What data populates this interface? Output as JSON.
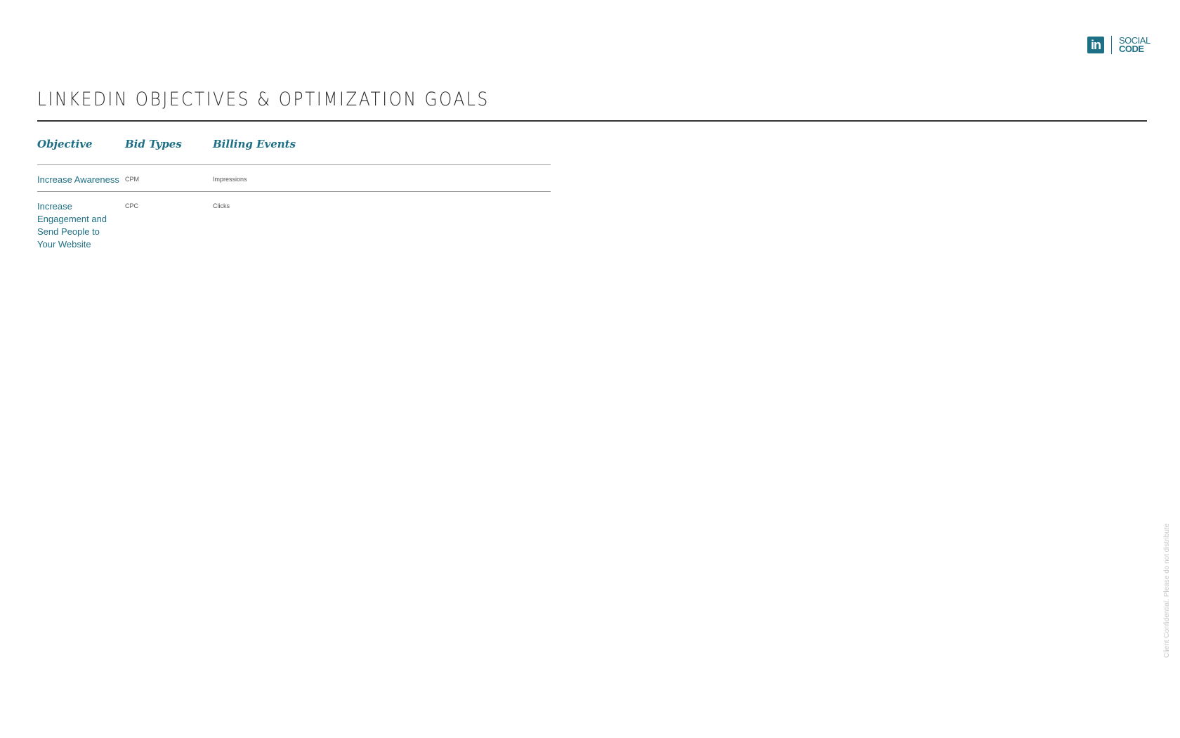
{
  "logo": {
    "linkedin_mark": "in",
    "brand_line1": "SOCIAL",
    "brand_line2": "CODE"
  },
  "page": {
    "title": "LINKEDIN OBJECTIVES & OPTIMIZATION GOALS"
  },
  "table": {
    "headers": {
      "objective": "Objective",
      "bid_types": "Bid Types",
      "billing_events": "Billing Events"
    },
    "rows": [
      {
        "objective": "Increase Awareness",
        "bid_type": "CPM",
        "billing_event": "Impressions"
      },
      {
        "objective": "Increase Engagement and Send People to Your Website",
        "bid_type": "CPC",
        "billing_event": "Clicks"
      }
    ]
  },
  "footer": {
    "confidential_note": "Client Confidential. Please do not distribute"
  },
  "colors": {
    "accent": "#1d6f85",
    "title_text": "#2c2c2c",
    "rule": "#333333"
  }
}
